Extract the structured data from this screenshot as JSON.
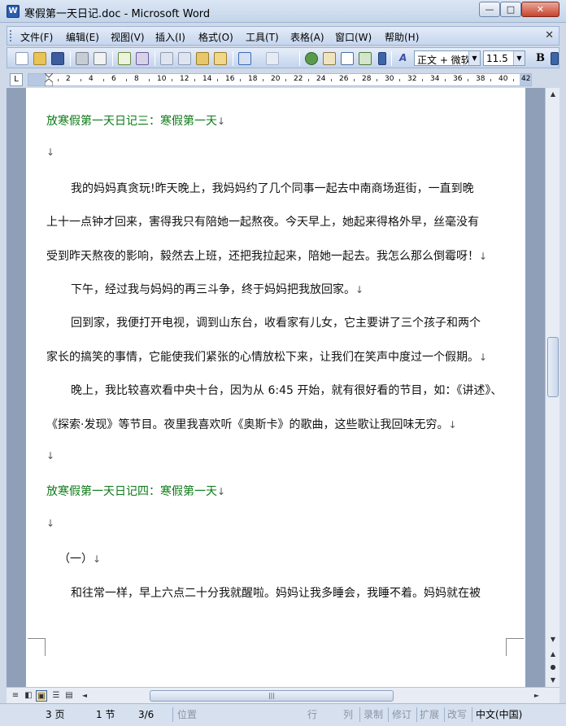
{
  "window": {
    "title": "寒假第一天日记.doc - Microsoft Word",
    "app_icon": "W",
    "controls": {
      "minimize": "—",
      "maximize": "□",
      "close": "✕"
    }
  },
  "menu": {
    "items": [
      "文件(F)",
      "编辑(E)",
      "视图(V)",
      "插入(I)",
      "格式(O)",
      "工具(T)",
      "表格(A)",
      "窗口(W)",
      "帮助(H)"
    ],
    "close_doc": "✕"
  },
  "toolbar": {
    "style_value": "正文 + 微软",
    "size_value": "11.5",
    "bold_label": "B",
    "styles_icon": "A"
  },
  "ruler": {
    "tab_selector": "L",
    "numbers": [
      "2",
      "4",
      "6",
      "8",
      "10",
      "12",
      "14",
      "16",
      "18",
      "20",
      "22",
      "24",
      "26",
      "28",
      "30",
      "32",
      "34",
      "36",
      "38",
      "40",
      "42"
    ]
  },
  "document": {
    "lines": [
      {
        "text": "放寒假第一天日记三：寒假第一天",
        "head": true,
        "mark": "↓",
        "indent": 0
      },
      {
        "text": "",
        "head": false,
        "mark": "↓",
        "indent": 0
      },
      {
        "text": "我的妈妈真贪玩!昨天晚上，我妈妈约了几个同事一起去中南商场逛街，一直到晚",
        "head": false,
        "mark": "",
        "indent": 2
      },
      {
        "text": "上十一点钟才回来，害得我只有陪她一起熬夜。今天早上，她起来得格外早，丝毫没有",
        "head": false,
        "mark": "",
        "indent": 0
      },
      {
        "text": "受到昨天熬夜的影响，毅然去上班，还把我拉起来，陪她一起去。我怎么那么倒霉呀！",
        "head": false,
        "mark": "↓",
        "indent": 0
      },
      {
        "text": "下午，经过我与妈妈的再三斗争，终于妈妈把我放回家。",
        "head": false,
        "mark": "↓",
        "indent": 2
      },
      {
        "text": "回到家，我便打开电视，调到山东台，收看家有儿女，它主要讲了三个孩子和两个",
        "head": false,
        "mark": "",
        "indent": 2
      },
      {
        "text": "家长的搞笑的事情，它能使我们紧张的心情放松下来，让我们在笑声中度过一个假期。",
        "head": false,
        "mark": "↓",
        "indent": 0
      },
      {
        "text": "晚上，我比较喜欢看中央十台，因为从 6:45 开始，就有很好看的节目，如：《讲述》、",
        "head": false,
        "mark": "",
        "indent": 2
      },
      {
        "text": "《探索·发现》等节目。夜里我喜欢听《奥斯卡》的歌曲，这些歌让我回味无穷。",
        "head": false,
        "mark": "↓",
        "indent": 0
      },
      {
        "text": "",
        "head": false,
        "mark": "↓",
        "indent": 0
      },
      {
        "text": "放寒假第一天日记四：寒假第一天",
        "head": true,
        "mark": "↓",
        "indent": 0
      },
      {
        "text": "",
        "head": false,
        "mark": "↓",
        "indent": 0
      },
      {
        "text": "（一）",
        "head": false,
        "mark": "↓",
        "indent": 1
      },
      {
        "text": "和往常一样，早上六点二十分我就醒啦。妈妈让我多睡会，我睡不着。妈妈就在被",
        "head": false,
        "mark": "",
        "indent": 2
      }
    ]
  },
  "status": {
    "page": "3 页",
    "section": "1 节",
    "page_of": "3/6",
    "position": "位置",
    "line": "行",
    "column": "列",
    "record": "录制",
    "revise": "修订",
    "extend": "扩展",
    "overtype": "改写",
    "language": "中文(中国)"
  }
}
